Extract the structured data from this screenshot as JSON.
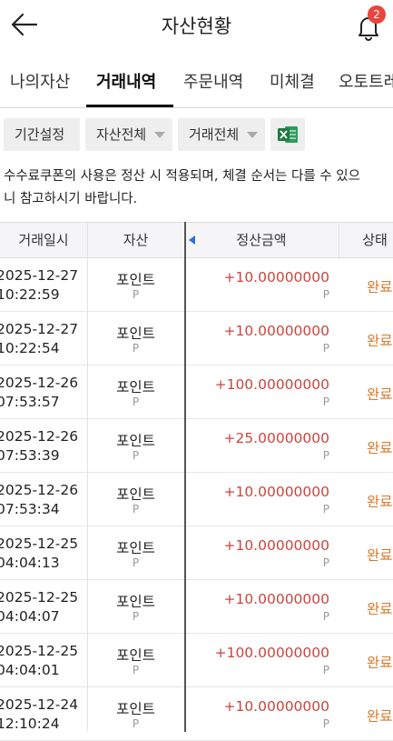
{
  "header": {
    "title": "자산현황",
    "notification_count": "2"
  },
  "tabs": [
    "나의자산",
    "거래내역",
    "주문내역",
    "미체결",
    "오토트레"
  ],
  "filters": {
    "period": "기간설정",
    "asset": "자산전체",
    "trade": "거래전체"
  },
  "notice": {
    "line1": "수수료쿠폰의 사용은 정산 시 적용되며, 체결 순서는 다를 수 있으",
    "line2": "니 참고하시기 바랍니다."
  },
  "table": {
    "headers": {
      "date": "거래일시",
      "asset": "자산",
      "amount": "정산금액",
      "status": "상태"
    },
    "rows": [
      {
        "date": "2025-12-27",
        "time": "10:22:59",
        "asset": "포인트",
        "asset_unit": "P",
        "amount": "+10.00000000",
        "amount_unit": "P",
        "status": "완료"
      },
      {
        "date": "2025-12-27",
        "time": "10:22:54",
        "asset": "포인트",
        "asset_unit": "P",
        "amount": "+10.00000000",
        "amount_unit": "P",
        "status": "완료"
      },
      {
        "date": "2025-12-26",
        "time": "07:53:57",
        "asset": "포인트",
        "asset_unit": "P",
        "amount": "+100.00000000",
        "amount_unit": "P",
        "status": "완료"
      },
      {
        "date": "2025-12-26",
        "time": "07:53:39",
        "asset": "포인트",
        "asset_unit": "P",
        "amount": "+25.00000000",
        "amount_unit": "P",
        "status": "완료"
      },
      {
        "date": "2025-12-26",
        "time": "07:53:34",
        "asset": "포인트",
        "asset_unit": "P",
        "amount": "+10.00000000",
        "amount_unit": "P",
        "status": "완료"
      },
      {
        "date": "2025-12-25",
        "time": "04:04:13",
        "asset": "포인트",
        "asset_unit": "P",
        "amount": "+10.00000000",
        "amount_unit": "P",
        "status": "완료"
      },
      {
        "date": "2025-12-25",
        "time": "04:04:07",
        "asset": "포인트",
        "asset_unit": "P",
        "amount": "+10.00000000",
        "amount_unit": "P",
        "status": "완료"
      },
      {
        "date": "2025-12-25",
        "time": "04:04:01",
        "asset": "포인트",
        "asset_unit": "P",
        "amount": "+100.00000000",
        "amount_unit": "P",
        "status": "완료"
      },
      {
        "date": "2025-12-24",
        "time": "12:10:24",
        "asset": "포인트",
        "asset_unit": "P",
        "amount": "+10.00000000",
        "amount_unit": "P",
        "status": "완료"
      }
    ]
  },
  "icons": {
    "back": "arrow-left-icon",
    "bell": "bell-icon",
    "excel": "excel-icon"
  },
  "colors": {
    "amount": "#c9463d",
    "status": "#d9782b",
    "badge": "#e8453c",
    "excel": "#1f7a44",
    "sort_arrow": "#2f6fd6"
  }
}
